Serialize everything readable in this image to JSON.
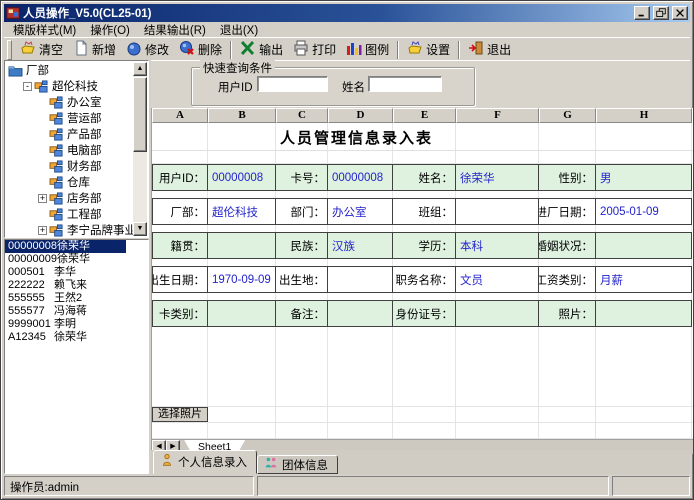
{
  "window": {
    "title": "人员操作_V5.0(CL25-01)"
  },
  "menu": {
    "items": [
      "模版样式(M)",
      "操作(O)",
      "结果输出(R)",
      "退出(X)"
    ]
  },
  "toolbar": {
    "groups": [
      [
        {
          "label": "清空",
          "icon": "clear-icon"
        },
        {
          "label": "新增",
          "icon": "new-icon"
        },
        {
          "label": "修改",
          "icon": "modify-icon"
        },
        {
          "label": "删除",
          "icon": "delete-icon"
        }
      ],
      [
        {
          "label": "输出",
          "icon": "export-icon"
        },
        {
          "label": "打印",
          "icon": "print-icon"
        },
        {
          "label": "图例",
          "icon": "legend-icon"
        }
      ],
      [
        {
          "label": "设置",
          "icon": "settings-icon"
        }
      ],
      [
        {
          "label": "退出",
          "icon": "exit-icon"
        }
      ]
    ]
  },
  "tree": {
    "items": [
      {
        "label": "厂部",
        "depth": 0,
        "icon": "folder-icon",
        "expand": null
      },
      {
        "label": "超伦科技",
        "depth": 1,
        "icon": "dept-icon",
        "expand": "-"
      },
      {
        "label": "办公室",
        "depth": 2,
        "icon": "dept-icon",
        "expand": null
      },
      {
        "label": "营运部",
        "depth": 2,
        "icon": "dept-icon",
        "expand": null
      },
      {
        "label": "产品部",
        "depth": 2,
        "icon": "dept-icon",
        "expand": null
      },
      {
        "label": "电脑部",
        "depth": 2,
        "icon": "dept-icon",
        "expand": null
      },
      {
        "label": "财务部",
        "depth": 2,
        "icon": "dept-icon",
        "expand": null
      },
      {
        "label": "仓库",
        "depth": 2,
        "icon": "dept-icon",
        "expand": null
      },
      {
        "label": "店务部",
        "depth": 2,
        "icon": "dept-icon",
        "expand": "+"
      },
      {
        "label": "工程部",
        "depth": 2,
        "icon": "dept-icon",
        "expand": null
      },
      {
        "label": "李宁品牌事业部",
        "depth": 2,
        "icon": "dept-icon",
        "expand": "+"
      }
    ]
  },
  "employee_list": {
    "items": [
      {
        "id": "00000008",
        "name": "徐荣华",
        "selected": true
      },
      {
        "id": "00000009",
        "name": "徐荣华",
        "selected": false
      },
      {
        "id": "000501",
        "name": "李华",
        "selected": false
      },
      {
        "id": "222222",
        "name": "赖飞来",
        "selected": false
      },
      {
        "id": "555555",
        "name": "王然2",
        "selected": false
      },
      {
        "id": "555577",
        "name": "冯海蒋",
        "selected": false
      },
      {
        "id": "9999001",
        "name": "李明",
        "selected": false
      },
      {
        "id": "A12345",
        "name": "徐荣华",
        "selected": false
      }
    ]
  },
  "query": {
    "legend": "快速查询条件",
    "fields": [
      {
        "label": "用户ID",
        "value": ""
      },
      {
        "label": "姓名",
        "value": ""
      }
    ]
  },
  "sheet": {
    "columns": [
      "A",
      "B",
      "C",
      "D",
      "E",
      "F",
      "G",
      "H"
    ],
    "form_title": "人员管理信息录入表",
    "rows": [
      {
        "bg": "green",
        "cells": [
          {
            "label": "用户ID：",
            "value": "00000008"
          },
          {
            "label": "卡号：",
            "value": "00000008"
          },
          {
            "label": "姓名：",
            "value": "徐荣华"
          },
          {
            "label": "性别：",
            "value": "男"
          }
        ]
      },
      {
        "bg": "white",
        "cells": [
          {
            "label": "厂部：",
            "value": "超伦科技"
          },
          {
            "label": "部门：",
            "value": "办公室"
          },
          {
            "label": "班组：",
            "value": ""
          },
          {
            "label": "进厂日期：",
            "value": "2005-01-09"
          }
        ]
      },
      {
        "bg": "green",
        "cells": [
          {
            "label": "籍贯：",
            "value": ""
          },
          {
            "label": "民族：",
            "value": "汉族"
          },
          {
            "label": "学历：",
            "value": "本科"
          },
          {
            "label": "婚姻状况：",
            "value": ""
          }
        ]
      },
      {
        "bg": "white",
        "cells": [
          {
            "label": "出生日期：",
            "value": "1970-09-09"
          },
          {
            "label": "出生地：",
            "value": ""
          },
          {
            "label": "职务名称：",
            "value": "文员"
          },
          {
            "label": "工资类别：",
            "value": "月薪"
          }
        ]
      },
      {
        "bg": "green",
        "cells": [
          {
            "label": "卡类别：",
            "value": ""
          },
          {
            "label": "备注：",
            "value": ""
          },
          {
            "label": "身份证号：",
            "value": ""
          },
          {
            "label": "照片：",
            "value": ""
          }
        ]
      }
    ],
    "photo_button_label": "选择照片",
    "tab_label": "Sheet1"
  },
  "bottom_tabs": [
    {
      "label": "个人信息录入",
      "icon": "person-icon",
      "active": true
    },
    {
      "label": "团体信息",
      "icon": "group-icon",
      "active": false
    }
  ],
  "status": {
    "operator": "操作员:admin"
  },
  "colors": {
    "titlebar_start": "#0a246a",
    "titlebar_end": "#a6caf0",
    "chrome": "#d4d0c8",
    "row_green": "#dff2df",
    "value_blue": "#2323cc",
    "selection_navy": "#0a246a"
  }
}
